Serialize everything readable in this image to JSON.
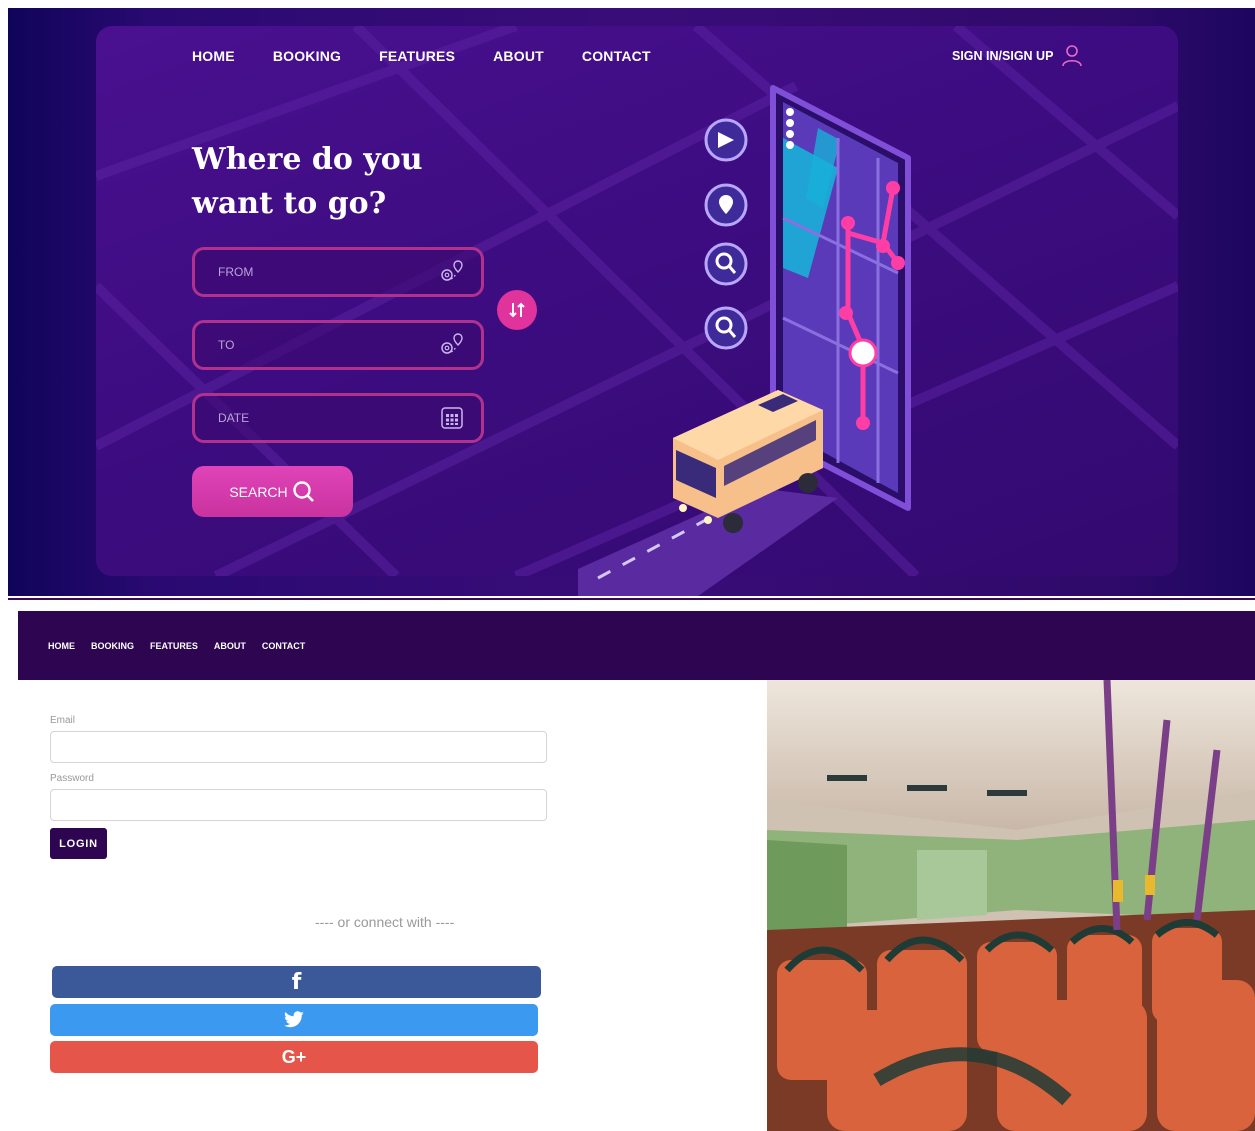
{
  "hero": {
    "nav": [
      "HOME",
      "BOOKING",
      "FEATURES",
      "ABOUT",
      "CONTACT"
    ],
    "signin_label": "SIGN IN/SIGN UP",
    "headline": "Where do you want to go?",
    "from_placeholder": "FROM",
    "to_placeholder": "TO",
    "date_placeholder": "DATE",
    "search_label": "SEARCH",
    "icons": [
      "user-icon",
      "location-pin-icon",
      "calendar-icon",
      "swap-icon",
      "search-icon"
    ]
  },
  "section2": {
    "nav": [
      "HOME",
      "BOOKING",
      "FEATURES",
      "ABOUT",
      "CONTACT"
    ],
    "email_label": "Email",
    "password_label": "Password",
    "login_label": "LOGIN",
    "connect_text": "---- or connect with ----",
    "social": {
      "facebook": "f",
      "google": "G+"
    },
    "icons": [
      "facebook-icon",
      "twitter-icon",
      "google-plus-icon"
    ]
  },
  "colors": {
    "hero_bg": "#3a0c78",
    "accent_pink": "#e0339c",
    "nav2_bg": "#2d0550",
    "facebook": "#3b5998",
    "twitter": "#3c99f0",
    "google": "#e5554a"
  }
}
